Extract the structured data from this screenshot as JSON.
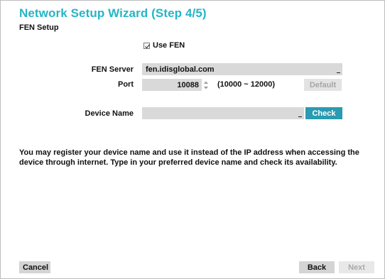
{
  "wizard": {
    "title": "Network Setup Wizard (Step 4/5)",
    "section": "FEN Setup"
  },
  "fen": {
    "use_fen_label": "Use FEN",
    "use_fen_checked": true,
    "server_label": "FEN Server",
    "server_value": "fen.idisglobal.com",
    "port_label": "Port",
    "port_value": "10088",
    "port_range": "(10000 ~ 12000)",
    "default_label": "Default",
    "device_name_label": "Device Name",
    "device_name_value": "",
    "check_label": "Check"
  },
  "description": "You may register your device name and use it instead of the IP address when accessing the device through internet. Type in your preferred device name and check its availability.",
  "footer": {
    "cancel_label": "Cancel",
    "back_label": "Back",
    "next_label": "Next"
  },
  "colors": {
    "accent": "#25b5c8",
    "check_button": "#2a9bb0",
    "field_bg": "#d9d9d9"
  }
}
